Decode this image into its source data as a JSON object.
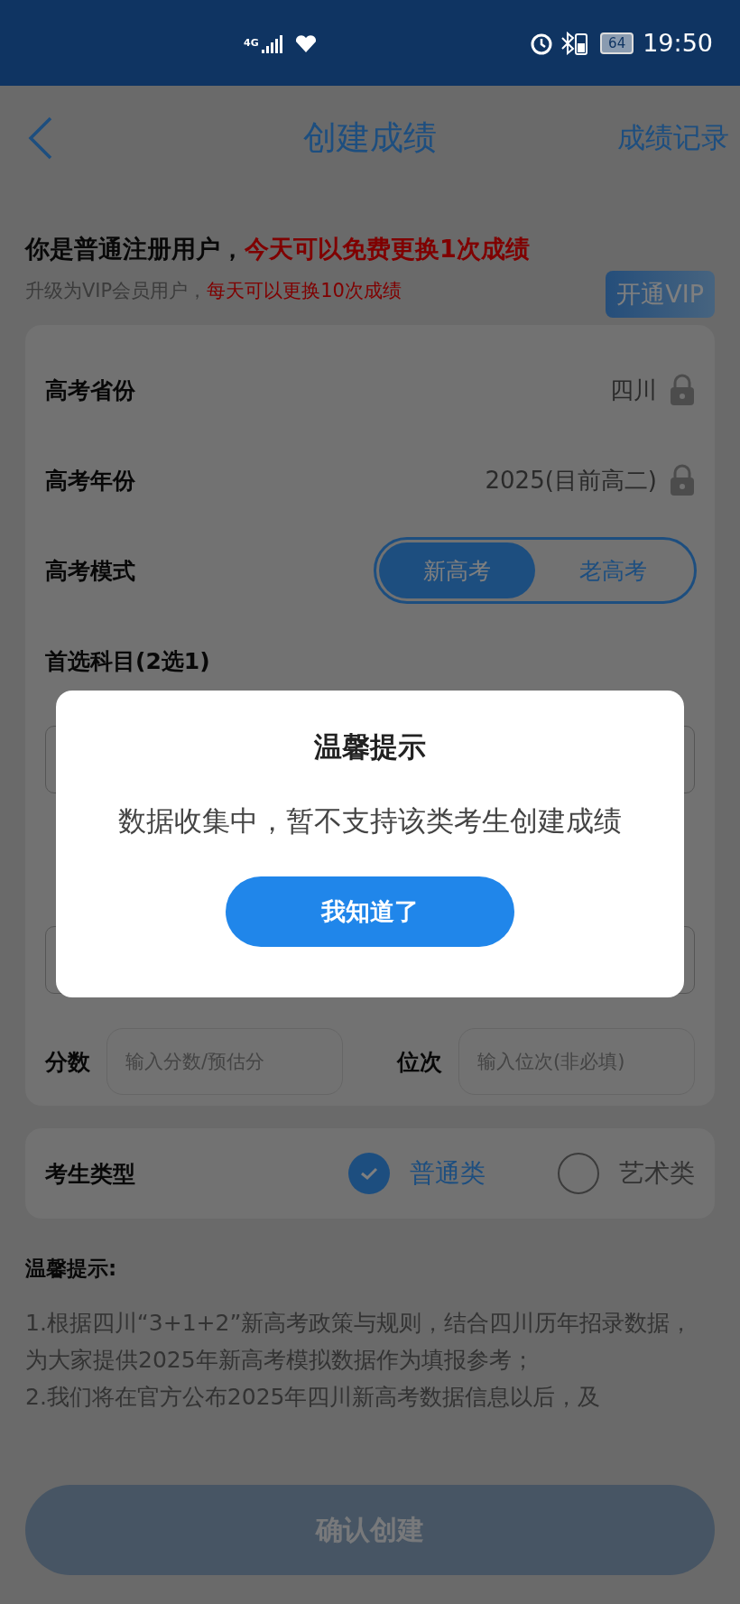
{
  "status_bar": {
    "network": "4G",
    "battery": "64",
    "time": "19:50"
  },
  "nav": {
    "title": "创建成绩",
    "right_link": "成绩记录"
  },
  "notice": {
    "lines": [
      {
        "parts": [
          {
            "text": "你是普通注册用户，",
            "highlight": false
          },
          {
            "text": "今天可以免费更换1次成绩",
            "highlight": true
          }
        ]
      },
      {
        "parts": [
          {
            "text": "升级为VIP会员用户，",
            "highlight": false
          },
          {
            "text": "每天可以更换10次成绩",
            "highlight": true
          }
        ]
      }
    ],
    "vip_button": "开通VIP"
  },
  "form": {
    "rows": [
      {
        "kind": "locked",
        "label": "高考省份",
        "value": "四川"
      },
      {
        "kind": "locked",
        "label": "高考年份",
        "value": "2025(目前高二)"
      },
      {
        "kind": "toggle",
        "label": "高考模式",
        "options": [
          {
            "label": "新高考",
            "selected": true
          },
          {
            "label": "老高考",
            "selected": false
          }
        ]
      },
      {
        "kind": "section",
        "label": "首选科目(2选1)"
      }
    ],
    "score_fields": [
      {
        "label": "分数",
        "placeholder": "输入分数/预估分"
      },
      {
        "label": "位次",
        "placeholder": "输入位次(非必填)"
      }
    ]
  },
  "student_type": {
    "label": "考生类型",
    "options": [
      {
        "label": "普通类",
        "selected": true
      },
      {
        "label": "艺术类",
        "selected": false
      }
    ]
  },
  "tips": {
    "title": "温馨提示:",
    "lines": [
      "1.根据四川“3+1+2”新高考政策与规则，结合四川历年招录数据，为大家提供2025年新高考模拟数据作为填报参考；",
      "2.我们将在官方公布2025年四川新高考数据信息以后，及"
    ]
  },
  "confirm_button": {
    "label": "确认创建",
    "disabled": true
  },
  "dialog": {
    "title": "温馨提示",
    "message": "数据收集中，暂不支持该类考生创建成绩",
    "button": "我知道了"
  }
}
